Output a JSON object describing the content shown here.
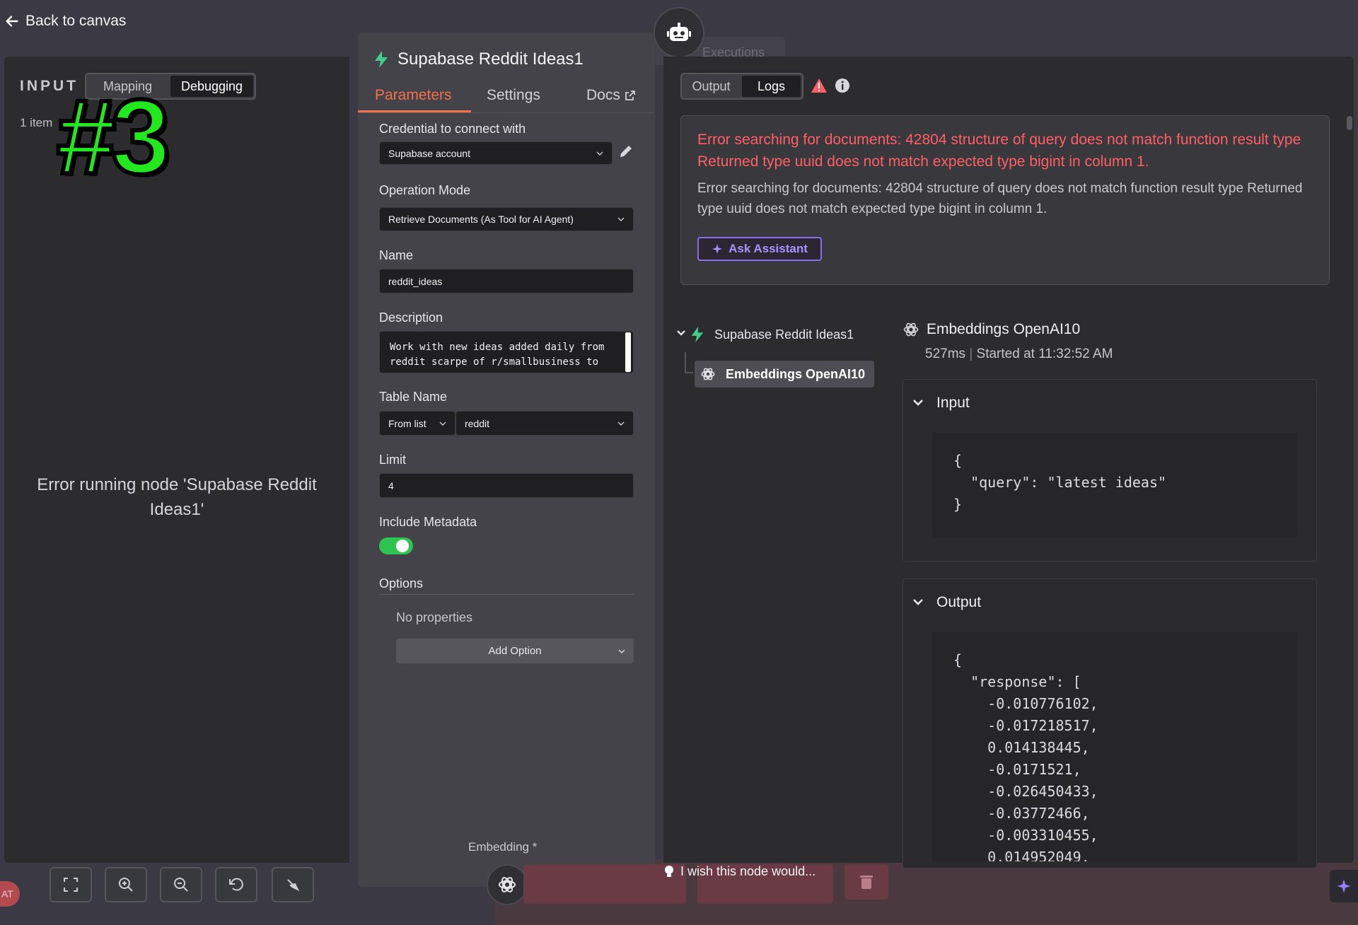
{
  "topbar": {
    "back_label": "Back to canvas",
    "canvas_tab": "Executions"
  },
  "input_panel": {
    "title": "INPUT",
    "modes": [
      "Mapping",
      "Debugging"
    ],
    "active_mode": "Debugging",
    "item_count": "1 item",
    "overlay_badge": "#3",
    "error_message": "Error running node 'Supabase Reddit Ideas1'"
  },
  "params_panel": {
    "node_title": "Supabase Reddit Ideas1",
    "tabs": {
      "parameters": "Parameters",
      "settings": "Settings",
      "docs": "Docs"
    },
    "credential": {
      "label": "Credential to connect with",
      "value": "Supabase account"
    },
    "operation_mode": {
      "label": "Operation Mode",
      "value": "Retrieve Documents (As Tool for AI Agent)"
    },
    "name": {
      "label": "Name",
      "value": "reddit_ideas"
    },
    "description": {
      "label": "Description",
      "line1": "Work with new ideas added daily from",
      "line2": "reddit scarpe of r/smallbusiness to"
    },
    "table_name": {
      "label": "Table Name",
      "mode": "From list",
      "value": "reddit"
    },
    "limit": {
      "label": "Limit",
      "value": "4"
    },
    "include_metadata": {
      "label": "Include Metadata",
      "enabled": true
    },
    "options": {
      "label": "Options",
      "empty_text": "No properties",
      "add_button": "Add Option"
    },
    "embedding_label": "Embedding *"
  },
  "output_panel": {
    "modes": [
      "Output",
      "Logs"
    ],
    "active_mode": "Logs",
    "error": {
      "title": "Error searching for documents: 42804 structure of query does not match function result type Returned type uuid does not match expected type bigint in column 1.",
      "description": "Error searching for documents: 42804 structure of query does not match function result type Returned type uuid does not match expected type bigint in column 1.",
      "assistant_button": "Ask Assistant"
    },
    "tree": {
      "parent": "Supabase Reddit Ideas1",
      "child": "Embeddings OpenAI10"
    },
    "detail": {
      "title": "Embeddings OpenAI10",
      "duration": "527ms",
      "started": "Started at 11:32:52 AM",
      "input_label": "Input",
      "input_lines": [
        "{",
        "  \"query\": \"latest ideas\"",
        "}"
      ],
      "output_label": "Output",
      "output_lines": [
        "{",
        "  \"response\": [",
        "    -0.010776102,",
        "    -0.017218517,",
        "    0.014138445,",
        "    -0.0171521,",
        "    -0.026450433,",
        "    -0.03772466,",
        "    -0.003310455,",
        "    0.014952049,"
      ]
    }
  },
  "bottom": {
    "avatar": "AT",
    "wish_text": "I wish this node would...",
    "controls": [
      "fit-view",
      "zoom-in",
      "zoom-out",
      "reset-zoom",
      "tidy-up"
    ]
  },
  "colors": {
    "accent": "#f2714a",
    "error": "#ff5f66",
    "success": "#2ec451",
    "assistant": "#8b6df0",
    "badge": "#22e81e"
  }
}
